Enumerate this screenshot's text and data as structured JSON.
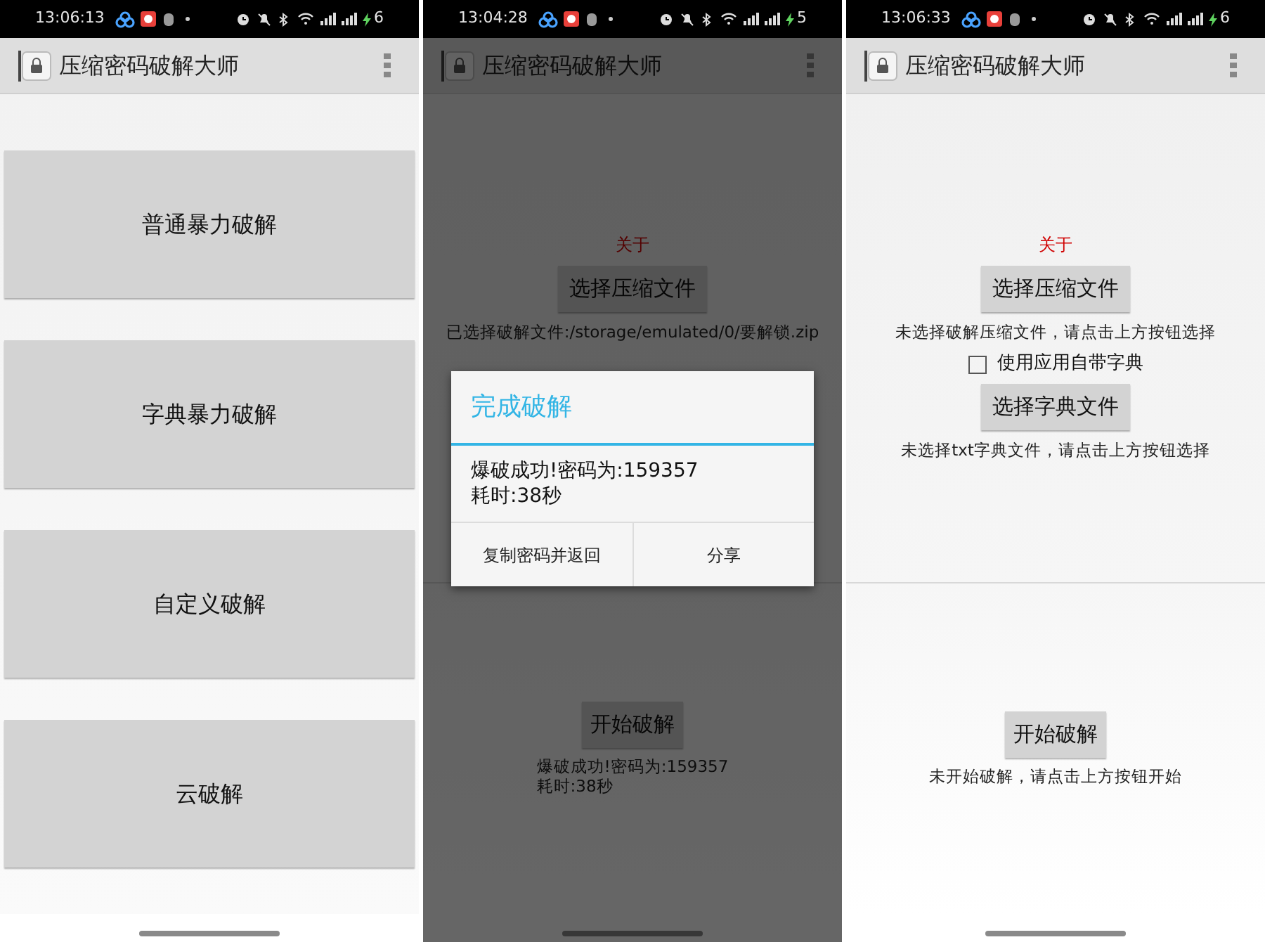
{
  "screens": [
    {
      "kind": "menu",
      "status_bar": {
        "time": "13:06:13",
        "battery": "6"
      },
      "app_bar": {
        "title": "压缩密码破解大师"
      },
      "buttons": [
        "普通暴力破解",
        "字典暴力破解",
        "自定义破解",
        "云破解"
      ]
    },
    {
      "kind": "crack",
      "status_bar": {
        "time": "13:04:28",
        "battery": "5"
      },
      "app_bar": {
        "title": "压缩密码破解大师"
      },
      "about": "关于",
      "file_button": "选择压缩文件",
      "file_status": "已选择破解文件:/storage/emulated/0/要解锁.zip",
      "start_button": "开始破解",
      "result_lines": [
        "爆破成功!密码为:159357",
        "耗时:38秒"
      ],
      "dialog": {
        "title": "完成破解",
        "message_lines": [
          "爆破成功!密码为:159357",
          "耗时:38秒"
        ],
        "buttons": [
          "复制密码并返回",
          "分享"
        ]
      }
    },
    {
      "kind": "crack",
      "status_bar": {
        "time": "13:06:33",
        "battery": "6"
      },
      "app_bar": {
        "title": "压缩密码破解大师"
      },
      "about": "关于",
      "file_button": "选择压缩文件",
      "file_status": "未选择破解压缩文件，请点击上方按钮选择",
      "dictionary": {
        "checkbox_label": "使用应用自带字典",
        "checked": false,
        "button": "选择字典文件",
        "status": "未选择txt字典文件，请点击上方按钮选择"
      },
      "start_button": "开始破解",
      "result_lines": [
        "未开始破解，请点击上方按钮开始"
      ]
    }
  ]
}
